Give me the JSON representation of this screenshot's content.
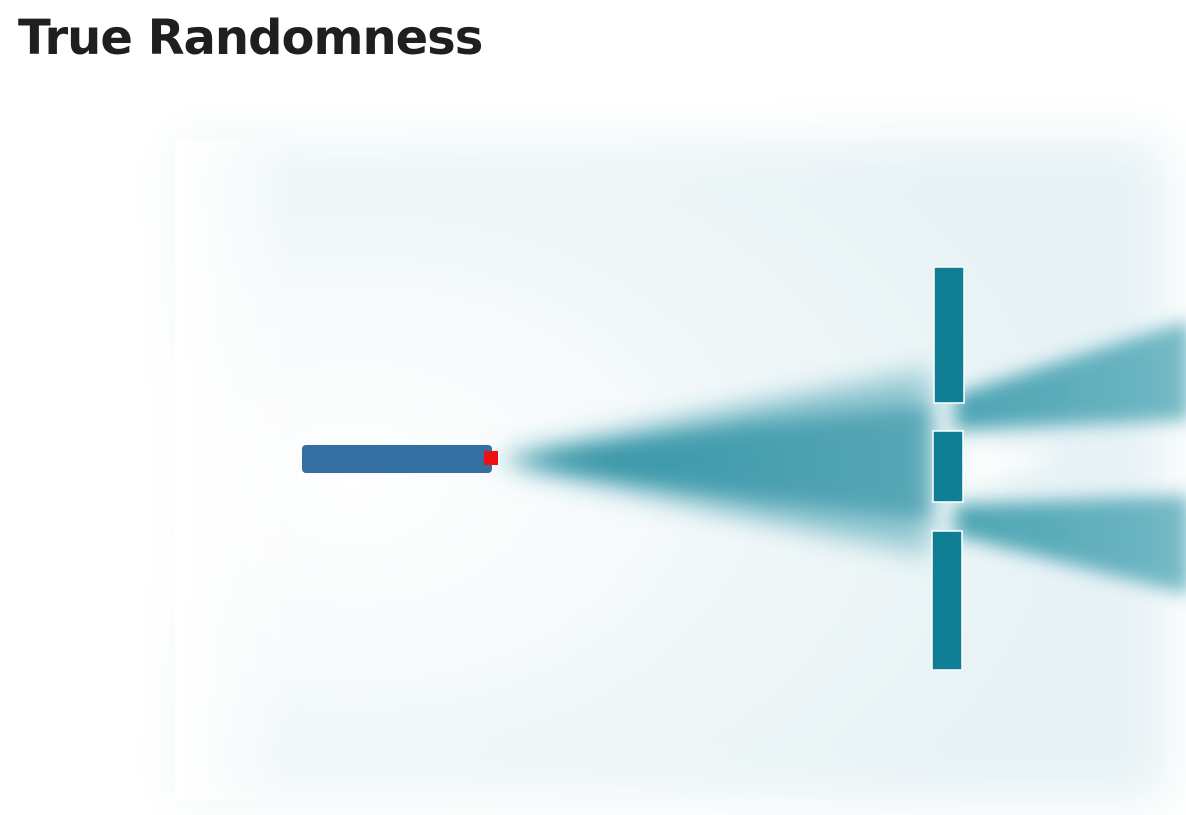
{
  "title": "True Randomness",
  "colors": {
    "background_tint": "#e8f3f6",
    "emitter_body": "#356ea1",
    "emitter_tip": "#ee1111",
    "beam": "#2f95a7",
    "slit_wall": "#107f95"
  },
  "icons": {
    "emitter": "particle-emitter-icon",
    "barrier": "double-slit-barrier-icon"
  }
}
